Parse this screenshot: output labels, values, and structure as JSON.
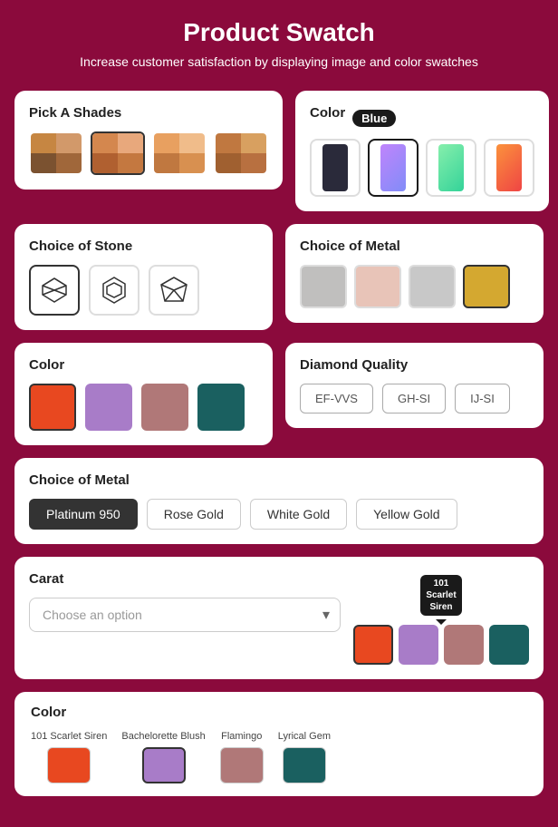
{
  "page": {
    "title": "Product Swatch",
    "subtitle": "Increase customer satisfaction by displaying image and color swatches"
  },
  "shades": {
    "title": "Pick A Shades",
    "swatches": [
      {
        "id": "s1",
        "cells": [
          "#C68642",
          "#D2996A",
          "#7B5230",
          "#A0673A"
        ],
        "active": false
      },
      {
        "id": "s2",
        "cells": [
          "#D4874E",
          "#E8A87C",
          "#B06030",
          "#C47840"
        ],
        "active": true
      },
      {
        "id": "s3",
        "cells": [
          "#E8A060",
          "#F0BC8A",
          "#C07840",
          "#D89050"
        ],
        "active": false
      },
      {
        "id": "s4",
        "cells": [
          "#C07840",
          "#D8A060",
          "#A06030",
          "#B87040"
        ],
        "active": false
      }
    ]
  },
  "color_top": {
    "title": "Color",
    "badge": "Blue",
    "phones": [
      {
        "id": "p1",
        "color": "dark",
        "active": false
      },
      {
        "id": "p2",
        "color": "purple",
        "active": true
      },
      {
        "id": "p3",
        "color": "green",
        "active": false
      },
      {
        "id": "p4",
        "color": "orange",
        "active": false
      }
    ]
  },
  "choice_of_stone": {
    "title": "Choice of Stone",
    "options": [
      {
        "id": "diamond1",
        "icon": "◇",
        "active": true
      },
      {
        "id": "diamond2",
        "icon": "⬡",
        "active": false
      },
      {
        "id": "diamond3",
        "icon": "◆",
        "active": false
      }
    ]
  },
  "choice_of_metal_top": {
    "title": "Choice of Metal",
    "swatches": [
      {
        "id": "m1",
        "color": "#C0BFBE",
        "active": false
      },
      {
        "id": "m2",
        "color": "#E8C4B8",
        "active": false
      },
      {
        "id": "m3",
        "color": "#C8C8C8",
        "active": false
      },
      {
        "id": "m4",
        "color": "#D4A830",
        "active": true
      }
    ]
  },
  "color_mid": {
    "title": "Color",
    "options": [
      {
        "id": "c1",
        "color": "#E84820",
        "active": true
      },
      {
        "id": "c2",
        "color": "#A87CC8",
        "active": false
      },
      {
        "id": "c3",
        "color": "#B07878",
        "active": false
      },
      {
        "id": "c4",
        "color": "#1A6060",
        "active": false
      }
    ]
  },
  "diamond_quality": {
    "title": "Diamond Quality",
    "options": [
      {
        "id": "q1",
        "label": "EF-VVS",
        "active": false
      },
      {
        "id": "q2",
        "label": "GH-SI",
        "active": false
      },
      {
        "id": "q3",
        "label": "IJ-SI",
        "active": false
      }
    ]
  },
  "choice_of_metal_bottom": {
    "title": "Choice of Metal",
    "tabs": [
      {
        "id": "t1",
        "label": "Platinum 950",
        "active": true
      },
      {
        "id": "t2",
        "label": "Rose Gold",
        "active": false
      },
      {
        "id": "t3",
        "label": "White Gold",
        "active": false
      },
      {
        "id": "t4",
        "label": "Yellow Gold",
        "active": false
      }
    ]
  },
  "carat": {
    "title": "Carat",
    "dropdown_placeholder": "Choose an option",
    "tooltip_badge": "101\nScarlet\nSiren",
    "swatches": [
      {
        "id": "cs1",
        "color": "#E84820",
        "active": false
      },
      {
        "id": "cs2",
        "color": "#A87CC8",
        "active": false
      },
      {
        "id": "cs3",
        "color": "#B07878",
        "active": false
      },
      {
        "id": "cs4",
        "color": "#1A6060",
        "active": false
      }
    ]
  },
  "color_bottom": {
    "title": "Color",
    "options": [
      {
        "id": "cb1",
        "label": "101 Scarlet Siren",
        "color": "#E84820",
        "active": false
      },
      {
        "id": "cb2",
        "label": "Bachelorette Blush",
        "color": "#A87CC8",
        "active": true
      },
      {
        "id": "cb3",
        "label": "Flamingo",
        "color": "#B07878",
        "active": false
      },
      {
        "id": "cb4",
        "label": "Lyrical Gem",
        "color": "#1A6060",
        "active": false
      }
    ]
  }
}
